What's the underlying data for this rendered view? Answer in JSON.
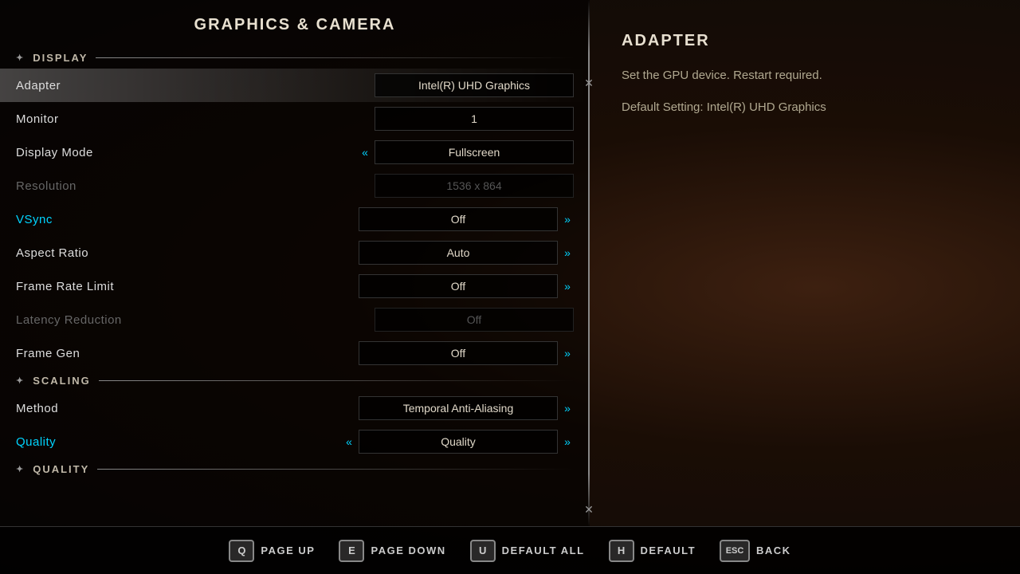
{
  "background": {
    "color": "#1a0d05"
  },
  "left_panel": {
    "title": "GRAPHICS & CAMERA",
    "sections": [
      {
        "id": "display",
        "label": "DISPLAY",
        "settings": [
          {
            "id": "adapter",
            "label": "Adapter",
            "value": "Intel(R) UHD Graphics",
            "state": "active",
            "has_left_arrow": false,
            "has_right_arrow": false,
            "disabled": false
          },
          {
            "id": "monitor",
            "label": "Monitor",
            "value": "1",
            "state": "normal",
            "has_left_arrow": false,
            "has_right_arrow": false,
            "disabled": false
          },
          {
            "id": "display_mode",
            "label": "Display Mode",
            "value": "Fullscreen",
            "state": "normal",
            "has_left_arrow": true,
            "has_right_arrow": false,
            "disabled": false
          },
          {
            "id": "resolution",
            "label": "Resolution",
            "value": "1536 x 864",
            "state": "normal",
            "has_left_arrow": false,
            "has_right_arrow": false,
            "disabled": true
          },
          {
            "id": "vsync",
            "label": "VSync",
            "value": "Off",
            "state": "highlighted",
            "has_left_arrow": false,
            "has_right_arrow": true,
            "disabled": false
          },
          {
            "id": "aspect_ratio",
            "label": "Aspect Ratio",
            "value": "Auto",
            "state": "normal",
            "has_left_arrow": false,
            "has_right_arrow": true,
            "disabled": false
          },
          {
            "id": "frame_rate_limit",
            "label": "Frame Rate Limit",
            "value": "Off",
            "state": "normal",
            "has_left_arrow": false,
            "has_right_arrow": true,
            "disabled": false
          },
          {
            "id": "latency_reduction",
            "label": "Latency Reduction",
            "value": "Off",
            "state": "normal",
            "has_left_arrow": false,
            "has_right_arrow": false,
            "disabled": true
          },
          {
            "id": "frame_gen",
            "label": "Frame Gen",
            "value": "Off",
            "state": "normal",
            "has_left_arrow": false,
            "has_right_arrow": true,
            "disabled": false
          }
        ]
      },
      {
        "id": "scaling",
        "label": "SCALING",
        "settings": [
          {
            "id": "method",
            "label": "Method",
            "value": "Temporal Anti-Aliasing",
            "state": "normal",
            "has_left_arrow": false,
            "has_right_arrow": true,
            "disabled": false
          },
          {
            "id": "quality",
            "label": "Quality",
            "value": "Quality",
            "state": "highlighted",
            "has_left_arrow": true,
            "has_right_arrow": true,
            "disabled": false
          }
        ]
      },
      {
        "id": "quality_section",
        "label": "QUALITY",
        "settings": []
      }
    ]
  },
  "right_panel": {
    "title": "ADAPTER",
    "description": "Set the GPU device. Restart required.",
    "default_label": "Default Setting:",
    "default_value": "Intel(R) UHD Graphics"
  },
  "bottom_bar": {
    "buttons": [
      {
        "id": "page_up",
        "key": "Q",
        "label": "PAGE UP"
      },
      {
        "id": "page_down",
        "key": "E",
        "label": "PAGE DOWN"
      },
      {
        "id": "default_all",
        "key": "U",
        "label": "DEFAULT ALL"
      },
      {
        "id": "default",
        "key": "H",
        "label": "DEFAULT"
      },
      {
        "id": "back",
        "key": "ESC",
        "label": "BACK"
      }
    ]
  }
}
